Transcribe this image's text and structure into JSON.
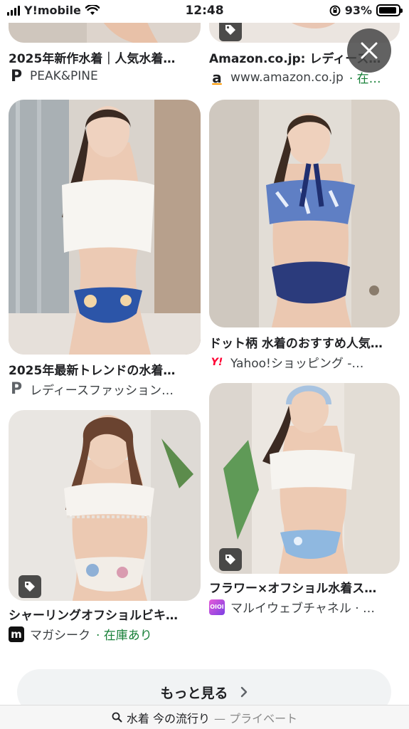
{
  "status_bar": {
    "carrier": "Y!mobile",
    "time": "12:48",
    "battery": "93%",
    "battery_level": 0.93,
    "icons": [
      "signal-icon",
      "wifi-icon",
      "orientation-lock-icon",
      "battery-icon"
    ]
  },
  "results": [
    {
      "title": "2025年新作水着｜人気水着…",
      "source": "PEAK&PINE",
      "source_suffix": "",
      "favicon": "P"
    },
    {
      "title": "Amazon.co.jp: レディース…",
      "source": "www.amazon.co.jp",
      "source_suffix": "· 在…",
      "favicon": "a"
    },
    {
      "title": "2025年最新トレンドの水着…",
      "source": "レディースファッション…",
      "source_suffix": "",
      "favicon": "P"
    },
    {
      "title": "ドット柄 水着のおすすめ人気…",
      "source": "Yahoo!ショッピング -…",
      "source_suffix": "",
      "favicon": "Y!"
    },
    {
      "title": "シャーリングオフショルビキ…",
      "source": "マガシーク",
      "source_suffix": "· 在庫あり",
      "favicon": "m"
    },
    {
      "title": "フラワー×オフショル水着ス…",
      "source": "マルイウェブチャネル · …",
      "source_suffix": "",
      "favicon": "OIOI"
    }
  ],
  "more_button": {
    "label": "もっと見る",
    "icon": "chevron-right-icon"
  },
  "url_bar": {
    "query": "水着 今の流行り",
    "private_label": "— プライベート",
    "icon": "search-icon"
  },
  "colors": {
    "in_stock": "#188038",
    "amazon_orange": "#ff9900",
    "yahoo_red": "#ff0033",
    "magaseek_black": "#111111",
    "marui_purple": "#7b3fe4"
  }
}
